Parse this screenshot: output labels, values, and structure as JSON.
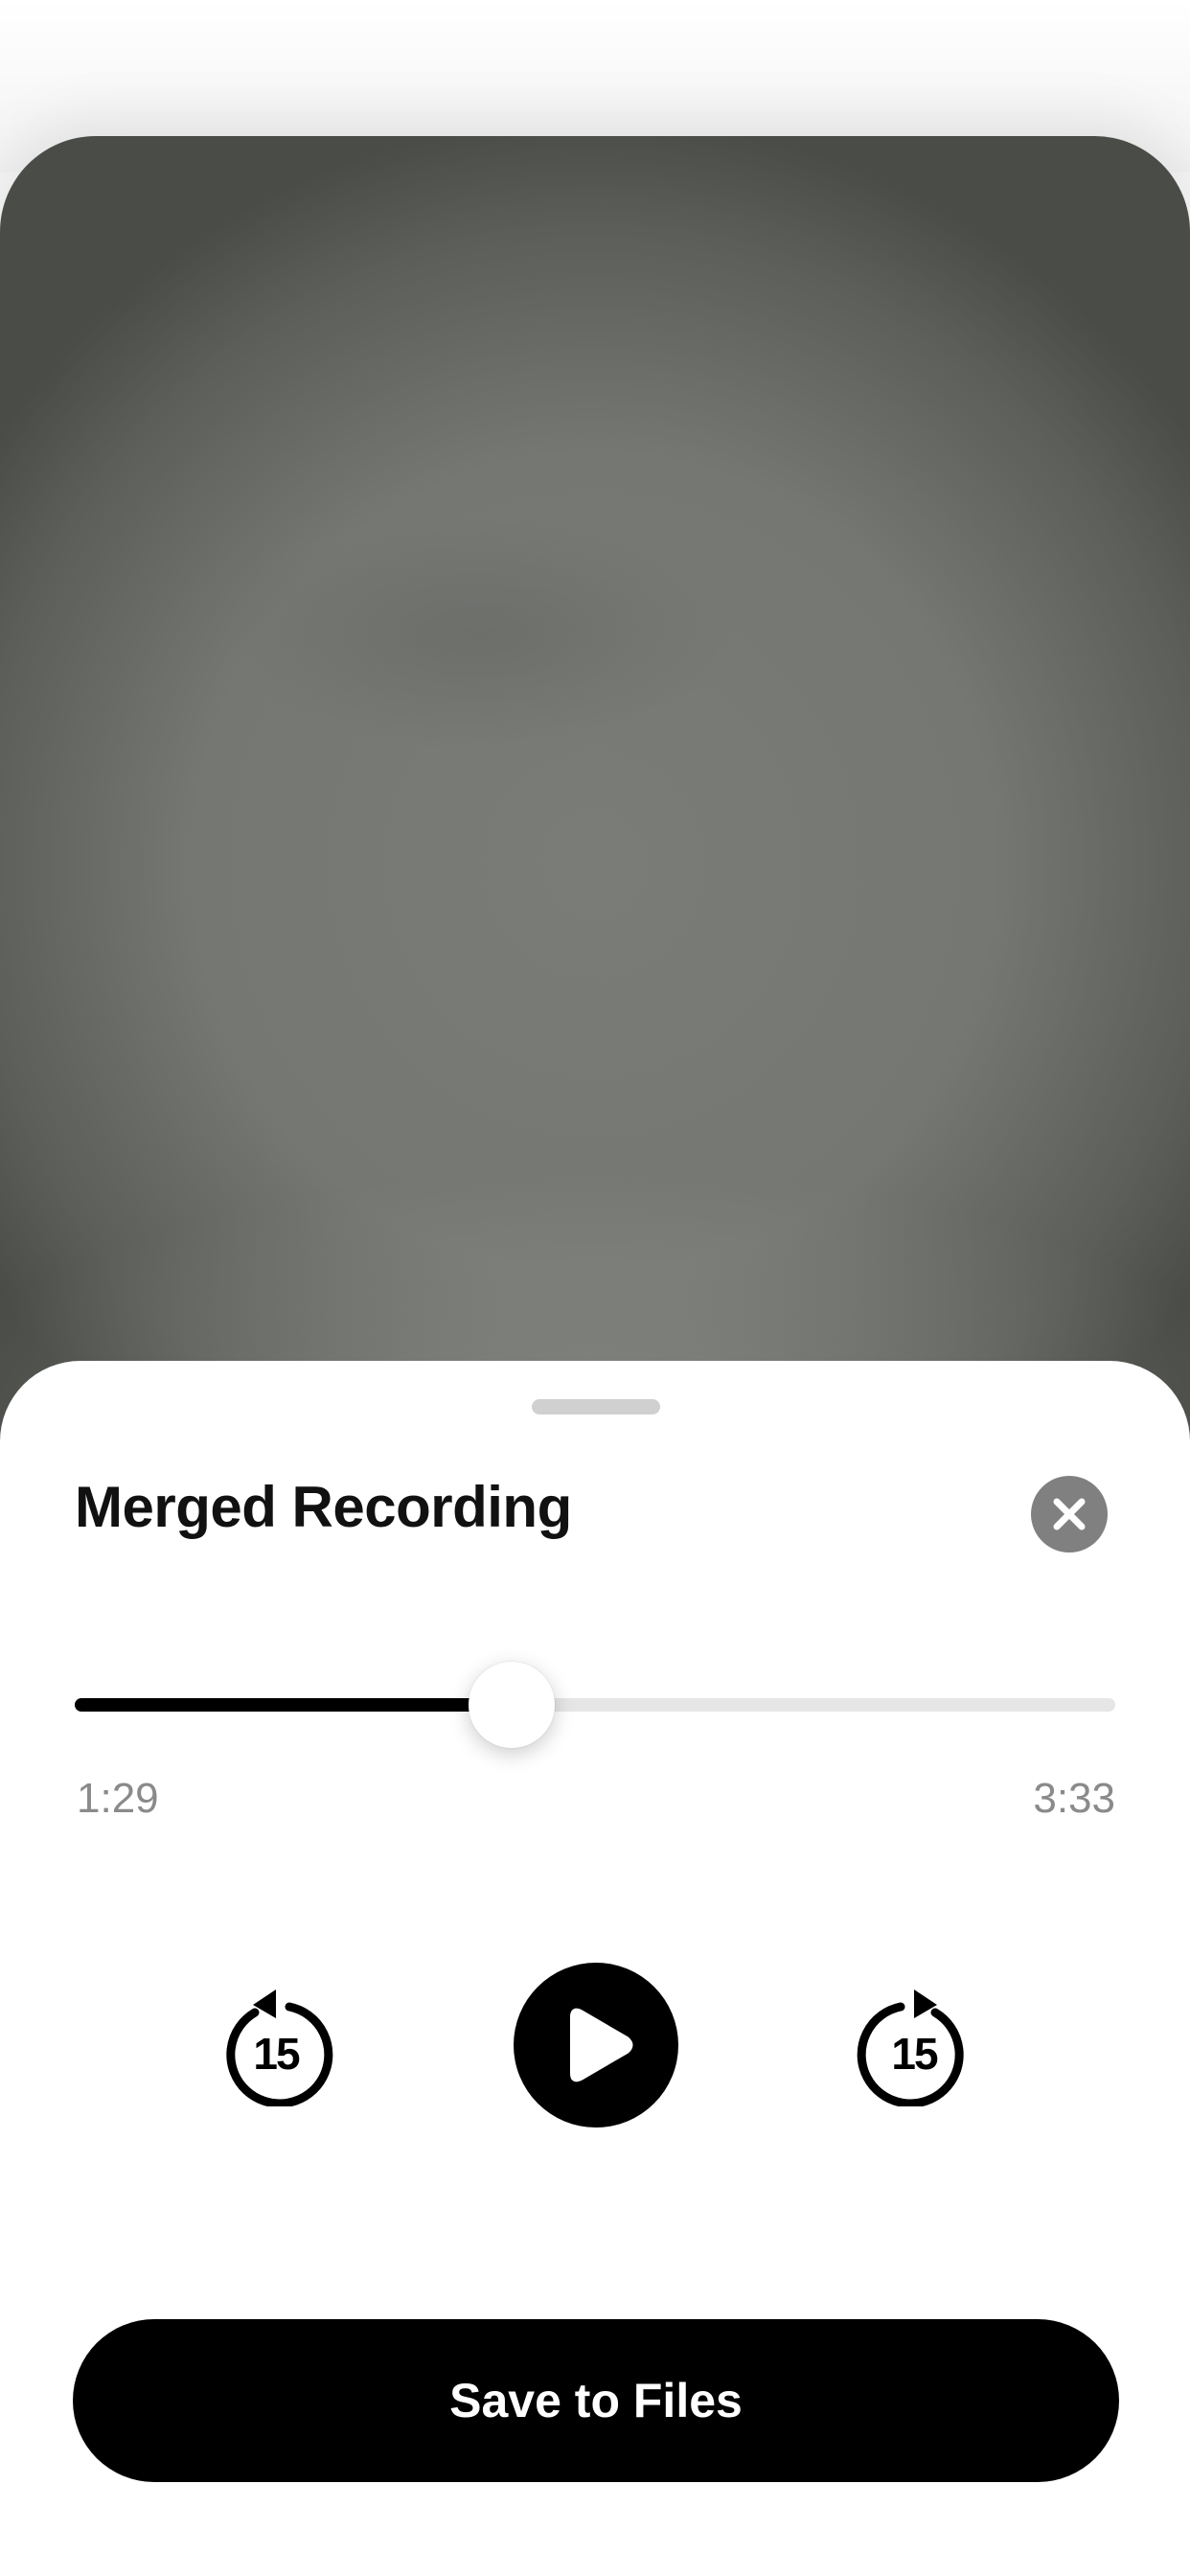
{
  "player": {
    "title": "Merged Recording",
    "elapsed": "1:29",
    "total": "3:33",
    "progress": 0.42,
    "skip_back_seconds": "15",
    "skip_forward_seconds": "15",
    "save_label": "Save to Files"
  },
  "icons": {
    "close": "close-icon",
    "play": "play-icon",
    "skip_back": "skip-back-15-icon",
    "skip_forward": "skip-forward-15-icon"
  },
  "colors": {
    "accent": "#000000",
    "close_button": "#808080",
    "time_text": "#8a8a8a",
    "track": "#e6e6e6"
  }
}
